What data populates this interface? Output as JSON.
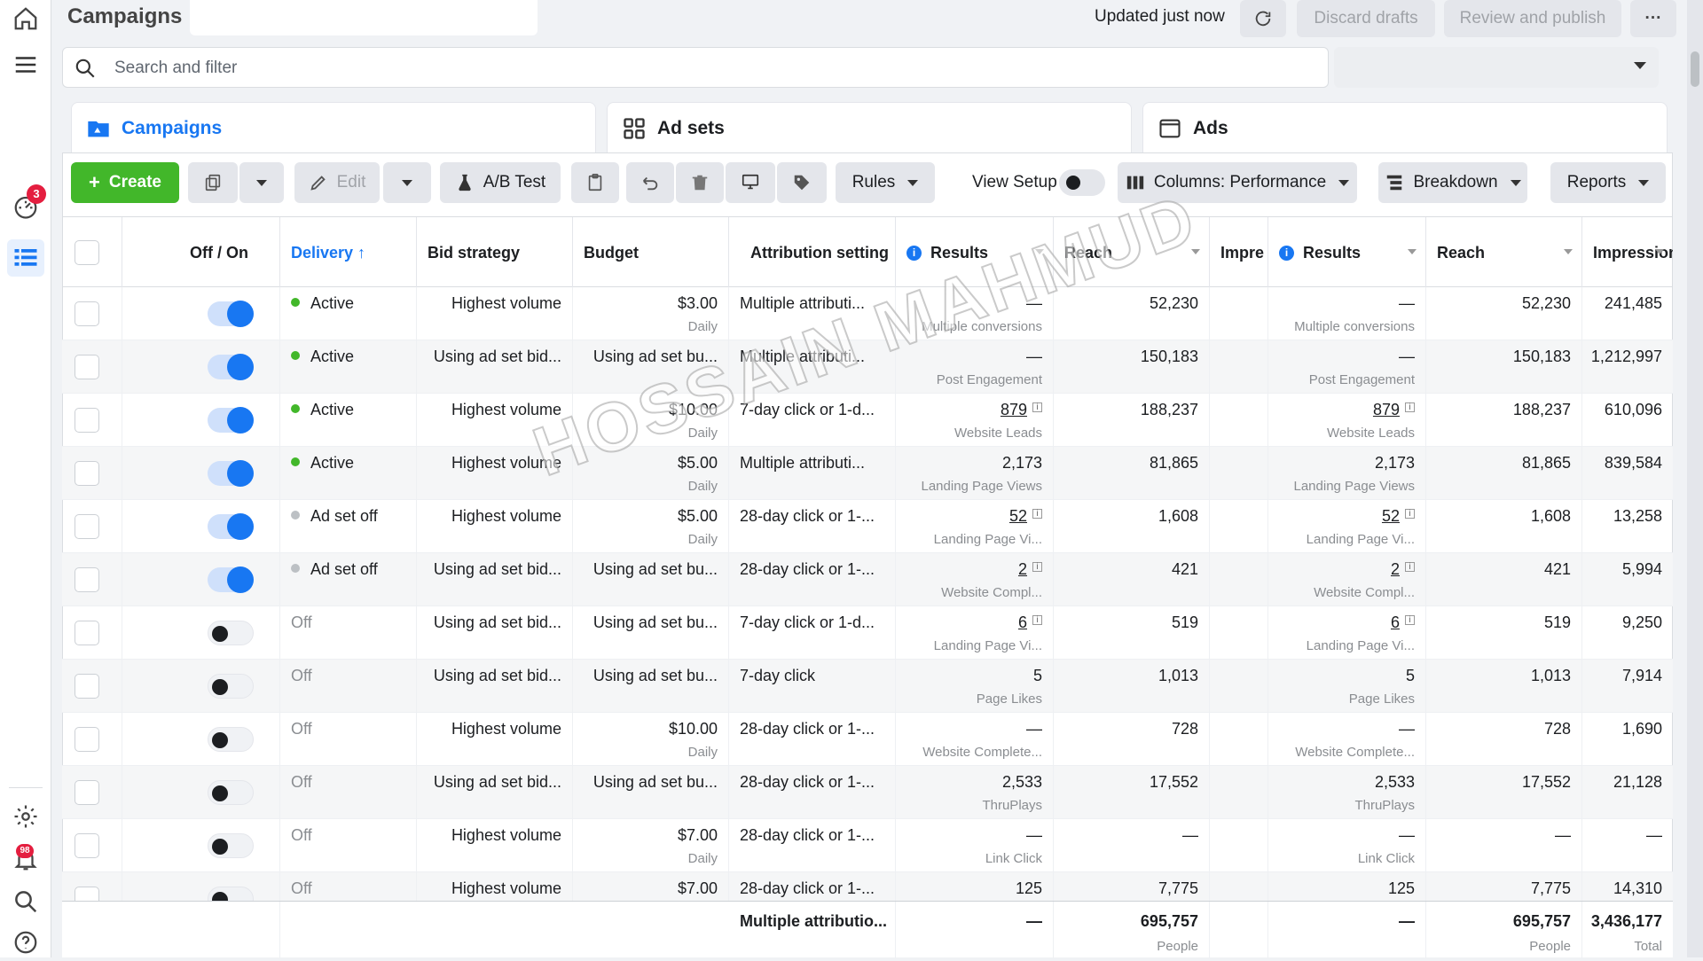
{
  "header": {
    "title": "Campaigns",
    "updated": "Updated just now",
    "discard_label": "Discard drafts",
    "publish_label": "Review and publish",
    "more_label": "···"
  },
  "rail": {
    "notif_badge": "3",
    "alerts_badge": "98"
  },
  "search": {
    "placeholder": "Search and filter"
  },
  "tabs": [
    {
      "label": "Campaigns",
      "icon": "folder-icon"
    },
    {
      "label": "Ad sets",
      "icon": "grid-icon"
    },
    {
      "label": "Ads",
      "icon": "ad-icon"
    }
  ],
  "toolbar": {
    "create_label": "Create",
    "edit_label": "Edit",
    "ab_label": "A/B Test",
    "rules_label": "Rules",
    "view_setup_label": "View Setup",
    "columns_label": "Columns: Performance",
    "breakdown_label": "Breakdown",
    "reports_label": "Reports"
  },
  "columns": [
    "Off / On",
    "Delivery ↑",
    "Bid strategy",
    "Budget",
    "Attribution setting",
    "Results",
    "Reach",
    "Impre",
    "Results",
    "Reach",
    "Impressions"
  ],
  "rows": [
    {
      "on": true,
      "delivery": "Active",
      "status": "active",
      "bid": "Highest volume",
      "budget": "$3.00",
      "budget_sub": "Daily",
      "attr": "Multiple attributi...",
      "res": "—",
      "res_sub": "Multiple conversions",
      "res_link": false,
      "reach": "52,230",
      "res2": "—",
      "res2_sub": "Multiple conversions",
      "reach2": "52,230",
      "impr": "241,485"
    },
    {
      "on": true,
      "delivery": "Active",
      "status": "active",
      "bid": "Using ad set bid...",
      "budget": "Using ad set bu...",
      "budget_sub": "",
      "attr": "Multiple attributi...",
      "res": "—",
      "res_sub": "Post Engagement",
      "res_link": false,
      "reach": "150,183",
      "res2": "—",
      "res2_sub": "Post Engagement",
      "reach2": "150,183",
      "impr": "1,212,997"
    },
    {
      "on": true,
      "delivery": "Active",
      "status": "active",
      "bid": "Highest volume",
      "budget": "$10.00",
      "budget_sub": "Daily",
      "attr": "7-day click or 1-d...",
      "res": "879",
      "res_sub": "Website Leads",
      "res_link": true,
      "reach": "188,237",
      "res2": "879",
      "res2_sub": "Website Leads",
      "reach2": "188,237",
      "impr": "610,096"
    },
    {
      "on": true,
      "delivery": "Active",
      "status": "active",
      "bid": "Highest volume",
      "budget": "$5.00",
      "budget_sub": "Daily",
      "attr": "Multiple attributi...",
      "res": "2,173",
      "res_sub": "Landing Page Views",
      "res_link": false,
      "reach": "81,865",
      "res2": "2,173",
      "res2_sub": "Landing Page Views",
      "reach2": "81,865",
      "impr": "839,584"
    },
    {
      "on": true,
      "delivery": "Ad set off",
      "status": "adsetoff",
      "bid": "Highest volume",
      "budget": "$5.00",
      "budget_sub": "Daily",
      "attr": "28-day click or 1-...",
      "res": "52",
      "res_sub": "Landing Page Vi...",
      "res_link": true,
      "reach": "1,608",
      "res2": "52",
      "res2_sub": "Landing Page Vi...",
      "reach2": "1,608",
      "impr": "13,258"
    },
    {
      "on": true,
      "delivery": "Ad set off",
      "status": "adsetoff",
      "bid": "Using ad set bid...",
      "budget": "Using ad set bu...",
      "budget_sub": "",
      "attr": "28-day click or 1-...",
      "res": "2",
      "res_sub": "Website Compl...",
      "res_link": true,
      "reach": "421",
      "res2": "2",
      "res2_sub": "Website Compl...",
      "reach2": "421",
      "impr": "5,994"
    },
    {
      "on": false,
      "delivery": "Off",
      "status": "off",
      "bid": "Using ad set bid...",
      "budget": "Using ad set bu...",
      "budget_sub": "",
      "attr": "7-day click or 1-d...",
      "res": "6",
      "res_sub": "Landing Page Vi...",
      "res_link": true,
      "reach": "519",
      "res2": "6",
      "res2_sub": "Landing Page Vi...",
      "reach2": "519",
      "impr": "9,250"
    },
    {
      "on": false,
      "delivery": "Off",
      "status": "off",
      "bid": "Using ad set bid...",
      "budget": "Using ad set bu...",
      "budget_sub": "",
      "attr": "7-day click",
      "res": "5",
      "res_sub": "Page Likes",
      "res_link": false,
      "reach": "1,013",
      "res2": "5",
      "res2_sub": "Page Likes",
      "reach2": "1,013",
      "impr": "7,914"
    },
    {
      "on": false,
      "delivery": "Off",
      "status": "off",
      "bid": "Highest volume",
      "budget": "$10.00",
      "budget_sub": "Daily",
      "attr": "28-day click or 1-...",
      "res": "—",
      "res_sub": "Website Complete...",
      "res_link": false,
      "reach": "728",
      "res2": "—",
      "res2_sub": "Website Complete...",
      "reach2": "728",
      "impr": "1,690"
    },
    {
      "on": false,
      "delivery": "Off",
      "status": "off",
      "bid": "Using ad set bid...",
      "budget": "Using ad set bu...",
      "budget_sub": "",
      "attr": "28-day click or 1-...",
      "res": "2,533",
      "res_sub": "ThruPlays",
      "res_link": false,
      "reach": "17,552",
      "res2": "2,533",
      "res2_sub": "ThruPlays",
      "reach2": "17,552",
      "impr": "21,128"
    },
    {
      "on": false,
      "delivery": "Off",
      "status": "off",
      "bid": "Highest volume",
      "budget": "$7.00",
      "budget_sub": "Daily",
      "attr": "28-day click or 1-...",
      "res": "—",
      "res_sub": "Link Click",
      "res_link": false,
      "reach": "—",
      "res2": "—",
      "res2_sub": "Link Click",
      "reach2": "—",
      "impr": "—"
    },
    {
      "on": false,
      "delivery": "Off",
      "status": "off",
      "bid": "Highest volume",
      "budget": "$7.00",
      "budget_sub": "",
      "attr": "28-day click or 1-...",
      "res": "125",
      "res_sub": "",
      "res_link": false,
      "reach": "7,775",
      "res2": "125",
      "res2_sub": "",
      "reach2": "7,775",
      "impr": "14,310"
    }
  ],
  "totals": {
    "attr": "Multiple attributio...",
    "res": "—",
    "reach": "695,757",
    "reach_sub": "People",
    "res2": "—",
    "reach2": "695,757",
    "reach2_sub": "People",
    "impr": "3,436,177",
    "impr_sub": "Total"
  },
  "watermark": "HOSSAIN MAHMUD",
  "colors": {
    "accent": "#1877f2",
    "create": "#42b72a",
    "active_dot": "#42b72a",
    "off_dot": "#bcc0c4",
    "badge": "#e41e3f"
  }
}
